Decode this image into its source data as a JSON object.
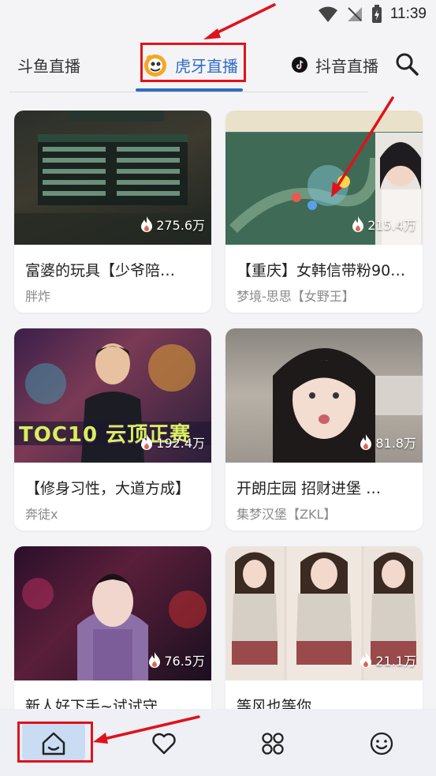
{
  "status_bar": {
    "time": "11:39"
  },
  "tabs": [
    {
      "label": "斗鱼直播",
      "selected": false
    },
    {
      "label": "虎牙直播",
      "selected": true
    },
    {
      "label": "抖音直播",
      "selected": false
    }
  ],
  "accent_color": "#2f6cc5",
  "annotation_color": "#e0121a",
  "cards": [
    {
      "title": "富婆的玩具【少爷陪…",
      "streamer": "胖炸",
      "viewers": "275.6万"
    },
    {
      "title": "【重庆】女韩信带粉90…",
      "streamer": "梦境-思思【女野王】",
      "viewers": "215.4万"
    },
    {
      "title": "【修身习性，大道方成】",
      "streamer": "奔徒x",
      "viewers": "192.4万"
    },
    {
      "title": "开朗庄园 招财进堡 …",
      "streamer": "集梦汉堡【ZKL】",
      "viewers": "81.8万"
    },
    {
      "title": "新人好下手~试试守…",
      "streamer": "",
      "viewers": "76.5万"
    },
    {
      "title": "等风也等你",
      "streamer": "",
      "viewers": "21.1万"
    }
  ],
  "thumbnail_texts": {
    "toc": "TOC10 云顶正赛"
  },
  "bottom_nav": [
    {
      "icon": "home-icon",
      "selected": true
    },
    {
      "icon": "heart-icon",
      "selected": false
    },
    {
      "icon": "apps-icon",
      "selected": false
    },
    {
      "icon": "smiley-icon",
      "selected": false
    }
  ]
}
